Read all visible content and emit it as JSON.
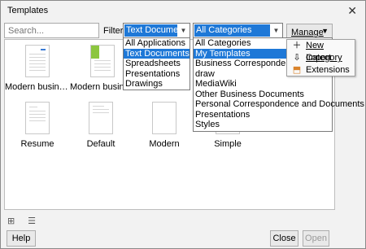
{
  "window": {
    "title": "Templates",
    "close_glyph": "✕"
  },
  "search": {
    "placeholder": "Search..."
  },
  "filter": {
    "label": "Filter",
    "selected": "Text Documents",
    "options": [
      "All Applications",
      "Text Documents",
      "Spreadsheets",
      "Presentations",
      "Drawings"
    ]
  },
  "category": {
    "selected": "All Categories",
    "options": [
      "All Categories",
      "My Templates",
      "Business Correspondence",
      "draw",
      "MediaWiki",
      "Other Business Documents",
      "Personal Correspondence and Documents",
      "Presentations",
      "Styles"
    ]
  },
  "manage": {
    "label": "Manage",
    "menu": [
      {
        "label": "New Category",
        "icon": "plus-icon"
      },
      {
        "label": "Import",
        "icon": "import-icon"
      },
      {
        "label": "Extensions",
        "icon": "extensions-icon"
      }
    ]
  },
  "templates": [
    {
      "name": "Modern business..."
    },
    {
      "name": "Modern business"
    },
    {
      "name": ""
    },
    {
      "name": "Resume"
    },
    {
      "name": "Default"
    },
    {
      "name": "Modern"
    },
    {
      "name": "Simple"
    }
  ],
  "footer": {
    "help": "Help",
    "close": "Close",
    "open": "Open"
  },
  "colors": {
    "selection": "#1e78d7",
    "accent_green": "#8cc63f",
    "accent_blue": "#3a7bd5"
  }
}
